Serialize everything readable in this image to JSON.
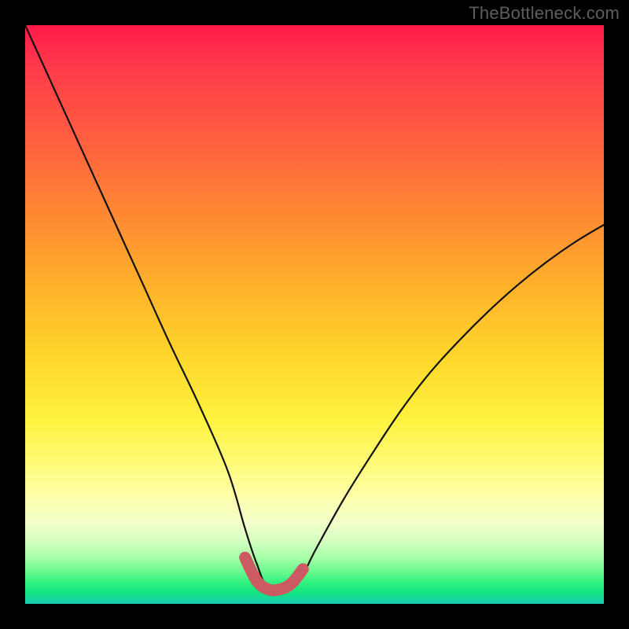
{
  "watermark": "TheBottleneck.com",
  "chart_data": {
    "type": "line",
    "title": "",
    "xlabel": "",
    "ylabel": "",
    "xlim": [
      0,
      100
    ],
    "ylim": [
      0,
      100
    ],
    "series": [
      {
        "name": "bottleneck-curve",
        "x": [
          0,
          5,
          10,
          15,
          20,
          25,
          30,
          35,
          38,
          40,
          42,
          46,
          48,
          50,
          55,
          60,
          65,
          70,
          75,
          80,
          85,
          90,
          95,
          100
        ],
        "values": [
          100,
          89,
          78,
          67,
          56,
          45,
          34.5,
          23,
          13,
          7,
          3,
          3,
          5,
          9,
          18,
          26,
          33.5,
          40,
          45.5,
          50.5,
          55,
          59,
          62.5,
          65.5
        ]
      },
      {
        "name": "highlight-band",
        "x": [
          38,
          40,
          42,
          44,
          46,
          48
        ],
        "values": [
          8,
          4,
          2.5,
          2.5,
          3.5,
          6
        ]
      }
    ],
    "colors": {
      "curve": "#111111",
      "highlight": "#cc5a62"
    }
  }
}
